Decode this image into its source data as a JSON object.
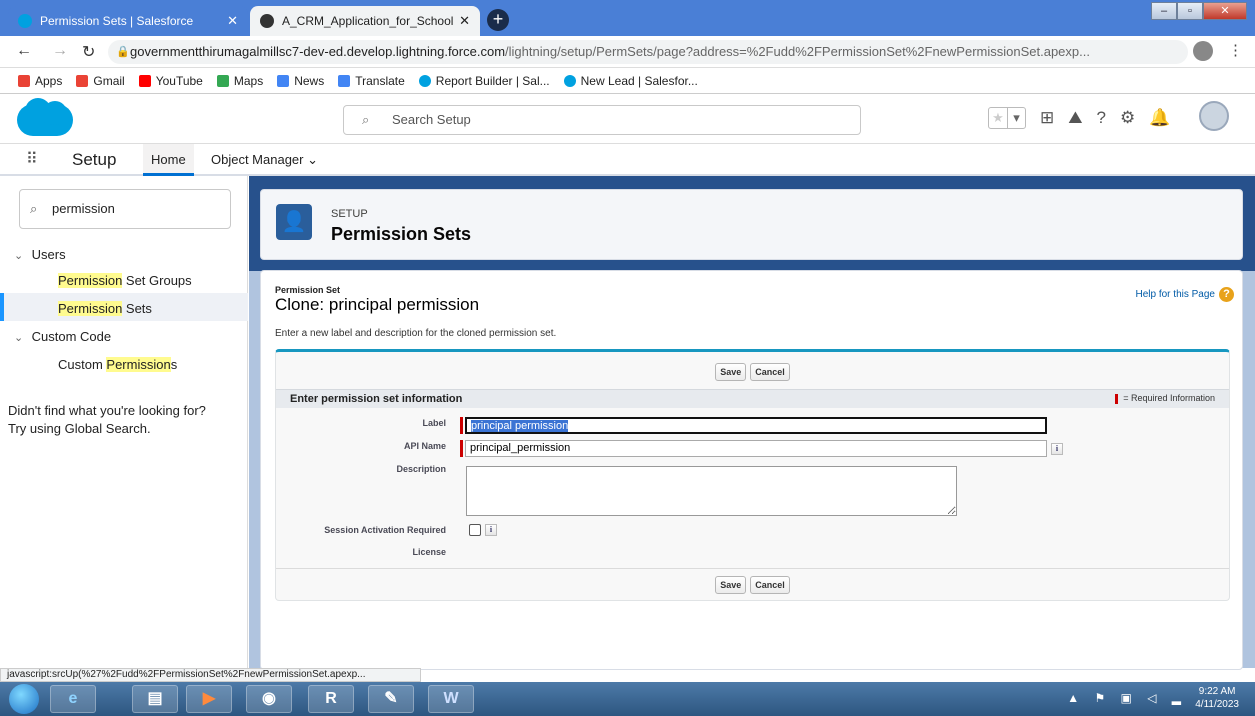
{
  "browser": {
    "tabs": [
      {
        "label": "Permission Sets | Salesforce",
        "active": true
      },
      {
        "label": "A_CRM_Application_for_Schools&",
        "active": false
      }
    ],
    "url_host": "governmentthirumagalmillsc7-dev-ed.develop.lightning.force.com",
    "url_path": "/lightning/setup/PermSets/page?address=%2Fudd%2FPermissionSet%2FnewPermissionSet.apexp...",
    "bookmarks": [
      "Apps",
      "Gmail",
      "YouTube",
      "Maps",
      "News",
      "Translate",
      "Report Builder | Sal...",
      "New Lead | Salesfor..."
    ],
    "status_url": "javascript:srcUp(%27%2Fudd%2FPermissionSet%2FnewPermissionSet.apexp..."
  },
  "sf_header": {
    "search_placeholder": "Search Setup"
  },
  "app_nav": {
    "app_name": "Setup",
    "tabs": [
      "Home",
      "Object Manager"
    ]
  },
  "sidebar": {
    "quick_find_value": "permission",
    "users_heading": "Users",
    "item_psg": {
      "hl": "Permission",
      "rest": " Set Groups"
    },
    "item_ps": {
      "hl": "Permission",
      "rest": " Sets"
    },
    "custom_code_heading": "Custom Code",
    "item_cp": {
      "pre": "Custom ",
      "hl": "Permission",
      "post": "s"
    },
    "not_found_line1": "Didn't find what you're looking for?",
    "not_found_line2": "Try using Global Search."
  },
  "setup_card": {
    "small": "SETUP",
    "title": "Permission Sets"
  },
  "form": {
    "type_label": "Permission Set",
    "title": "Clone: principal permission",
    "help_link": "Help for this Page",
    "intro": "Enter a new label and description for the cloned permission set.",
    "save_label": "Save",
    "cancel_label": "Cancel",
    "section_title": "Enter permission set information",
    "required_legend": "= Required Information",
    "fields": {
      "label": {
        "name": "Label",
        "value": "principal permission"
      },
      "api_name": {
        "name": "API Name",
        "value": "principal_permission"
      },
      "description": {
        "name": "Description",
        "value": ""
      },
      "session": {
        "name": "Session Activation Required"
      },
      "license": {
        "name": "License",
        "value": ""
      }
    }
  },
  "taskbar": {
    "clock_time": "9:22 AM",
    "clock_date": "4/11/2023"
  },
  "colors": {
    "salesforce_blue": "#00a1e0",
    "setup_header": "#27518c",
    "link": "#015ba7",
    "required": "#cc0000",
    "highlight": "#fffb8f"
  }
}
